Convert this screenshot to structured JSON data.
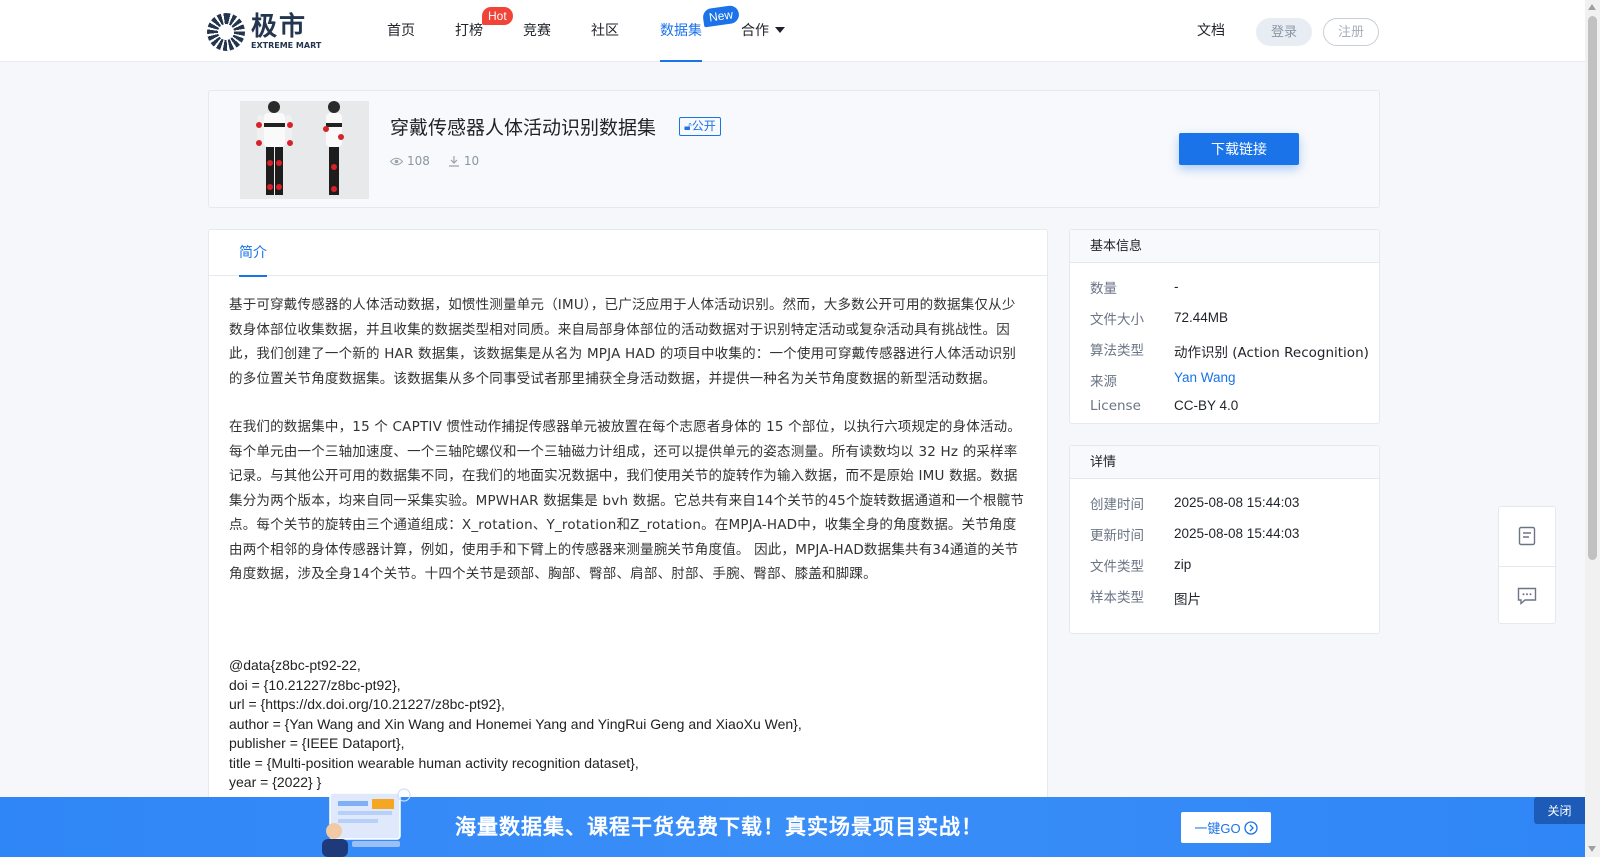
{
  "brand": {
    "name_cn": "极市",
    "name_en": "EXTREME MART"
  },
  "nav": {
    "items": [
      {
        "label": "首页"
      },
      {
        "label": "打榜",
        "badge": "Hot"
      },
      {
        "label": "竞赛"
      },
      {
        "label": "社区"
      },
      {
        "label": "数据集",
        "badge": "New",
        "active": true
      },
      {
        "label": "合作",
        "dropdown": true
      }
    ]
  },
  "header_right": {
    "docs": "文档",
    "login": "登录",
    "register": "注册"
  },
  "dataset": {
    "title": "穿戴传感器人体活动识别数据集",
    "visibility": "公开",
    "views": "108",
    "downloads": "10",
    "download_button": "下载链接"
  },
  "tabs": [
    {
      "label": "简介"
    }
  ],
  "description": [
    "基于可穿戴传感器的人体活动数据，如惯性测量单元（IMU），已广泛应用于人体活动识别。然而，大多数公开可用的数据集仅从少数身体部位收集数据，并且收集的数据类型相对同质。来自局部身体部位的活动数据对于识别特定活动或复杂活动具有挑战性。因此，我们创建了一个新的 HAR 数据集，该数据集是从名为 MPJA HAD 的项目中收集的：一个使用可穿戴传感器进行人体活动识别的多位置关节角度数据集。该数据集从多个同事受试者那里捕获全身活动数据，并提供一种名为关节角度数据的新型活动数据。",
    "在我们的数据集中，15 个 CAPTIV 惯性动作捕捉传感器单元被放置在每个志愿者身体的 15 个部位，以执行六项规定的身体活动。每个单元由一个三轴加速度、一个三轴陀螺仪和一个三轴磁力计组成，还可以提供单元的姿态测量。所有读数均以 32 Hz 的采样率记录。与其他公开可用的数据集不同，在我们的地面实况数据中，我们使用关节的旋转作为输入数据，而不是原始 IMU 数据。数据集分为两个版本，均来自同一采集实验。MPWHAR 数据集是 bvh 数据。它总共有来自14个关节的45个旋转数据通道和一个根髋节点。每个关节的旋转由三个通道组成：X_rotation、Y_rotation和Z_rotation。在MPJA-HAD中，收集全身的角度数据。关节角度由两个相邻的身体传感器计算，例如，使用手和下臂上的传感器来测量腕关节角度值。 因此，MPJA-HAD数据集共有34通道的关节角度数据，涉及全身14个关节。十四个关节是颈部、胸部、臀部、肩部、肘部、手腕、臀部、膝盖和脚踝。"
  ],
  "citation": [
    "@data{z8bc-pt92-22,",
    "doi = {10.21227/z8bc-pt92},",
    "url = {https://dx.doi.org/10.21227/z8bc-pt92},",
    "author = {Yan Wang and Xin Wang and Honemei Yang and YingRui Geng and XiaoXu Wen},",
    "publisher = {IEEE Dataport},",
    "title = {Multi-position wearable human activity recognition dataset},",
    "year = {2022} }"
  ],
  "basic_info": {
    "title": "基本信息",
    "rows": [
      {
        "key": "数量",
        "value": "-"
      },
      {
        "key": "文件大小",
        "value": "72.44MB"
      },
      {
        "key": "算法类型",
        "value": "动作识别 (Action Recognition)"
      },
      {
        "key": "来源",
        "value": "Yan Wang"
      },
      {
        "key": "License",
        "value": "CC-BY 4.0"
      }
    ]
  },
  "details": {
    "title": "详情",
    "rows": [
      {
        "key": "创建时间",
        "value": "2025-08-08 15:44:03"
      },
      {
        "key": "更新时间",
        "value": "2025-08-08 15:44:03"
      },
      {
        "key": "文件类型",
        "value": "zip"
      },
      {
        "key": "样本类型",
        "value": "图片"
      }
    ]
  },
  "banner": {
    "text": "海量数据集、课程干货免费下载！真实场景项目实战！",
    "button": "一键GO",
    "close": "关闭"
  },
  "colors": {
    "accent": "#1a73e8",
    "hot": "#f04438",
    "banner": "#2f86f6"
  }
}
